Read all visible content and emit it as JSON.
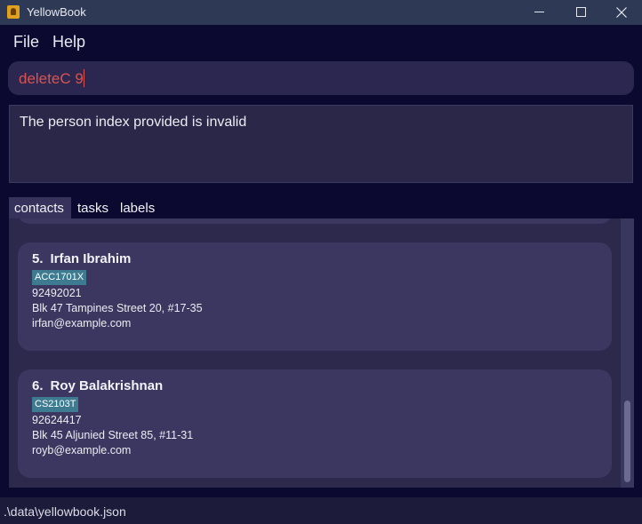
{
  "window": {
    "title": "YellowBook",
    "minimize": "minimize",
    "maximize": "maximize",
    "close": "close"
  },
  "menu": {
    "file": "File",
    "help": "Help"
  },
  "command": {
    "value": "deleteC 9"
  },
  "result": {
    "message": "The person index provided is invalid"
  },
  "tabs": [
    {
      "label": "contacts",
      "selected": true
    },
    {
      "label": "tasks",
      "selected": false
    },
    {
      "label": "labels",
      "selected": false
    }
  ],
  "contacts": [
    {
      "index": "5.",
      "name": "Irfan Ibrahim",
      "tag": "ACC1701X",
      "phone": "92492021",
      "address": "Blk 47 Tampines Street 20, #17-35",
      "email": "irfan@example.com"
    },
    {
      "index": "6.",
      "name": "Roy Balakrishnan",
      "tag": "CS2103T",
      "phone": "92624417",
      "address": "Blk 45 Aljunied Street 85, #11-31",
      "email": "royb@example.com"
    }
  ],
  "status": {
    "file_path": ".\\data\\yellowbook.json"
  },
  "colors": {
    "background": "#0b0930",
    "card": "#3b3760",
    "tag": "#3e7b91",
    "error_text": "#d9534f"
  }
}
